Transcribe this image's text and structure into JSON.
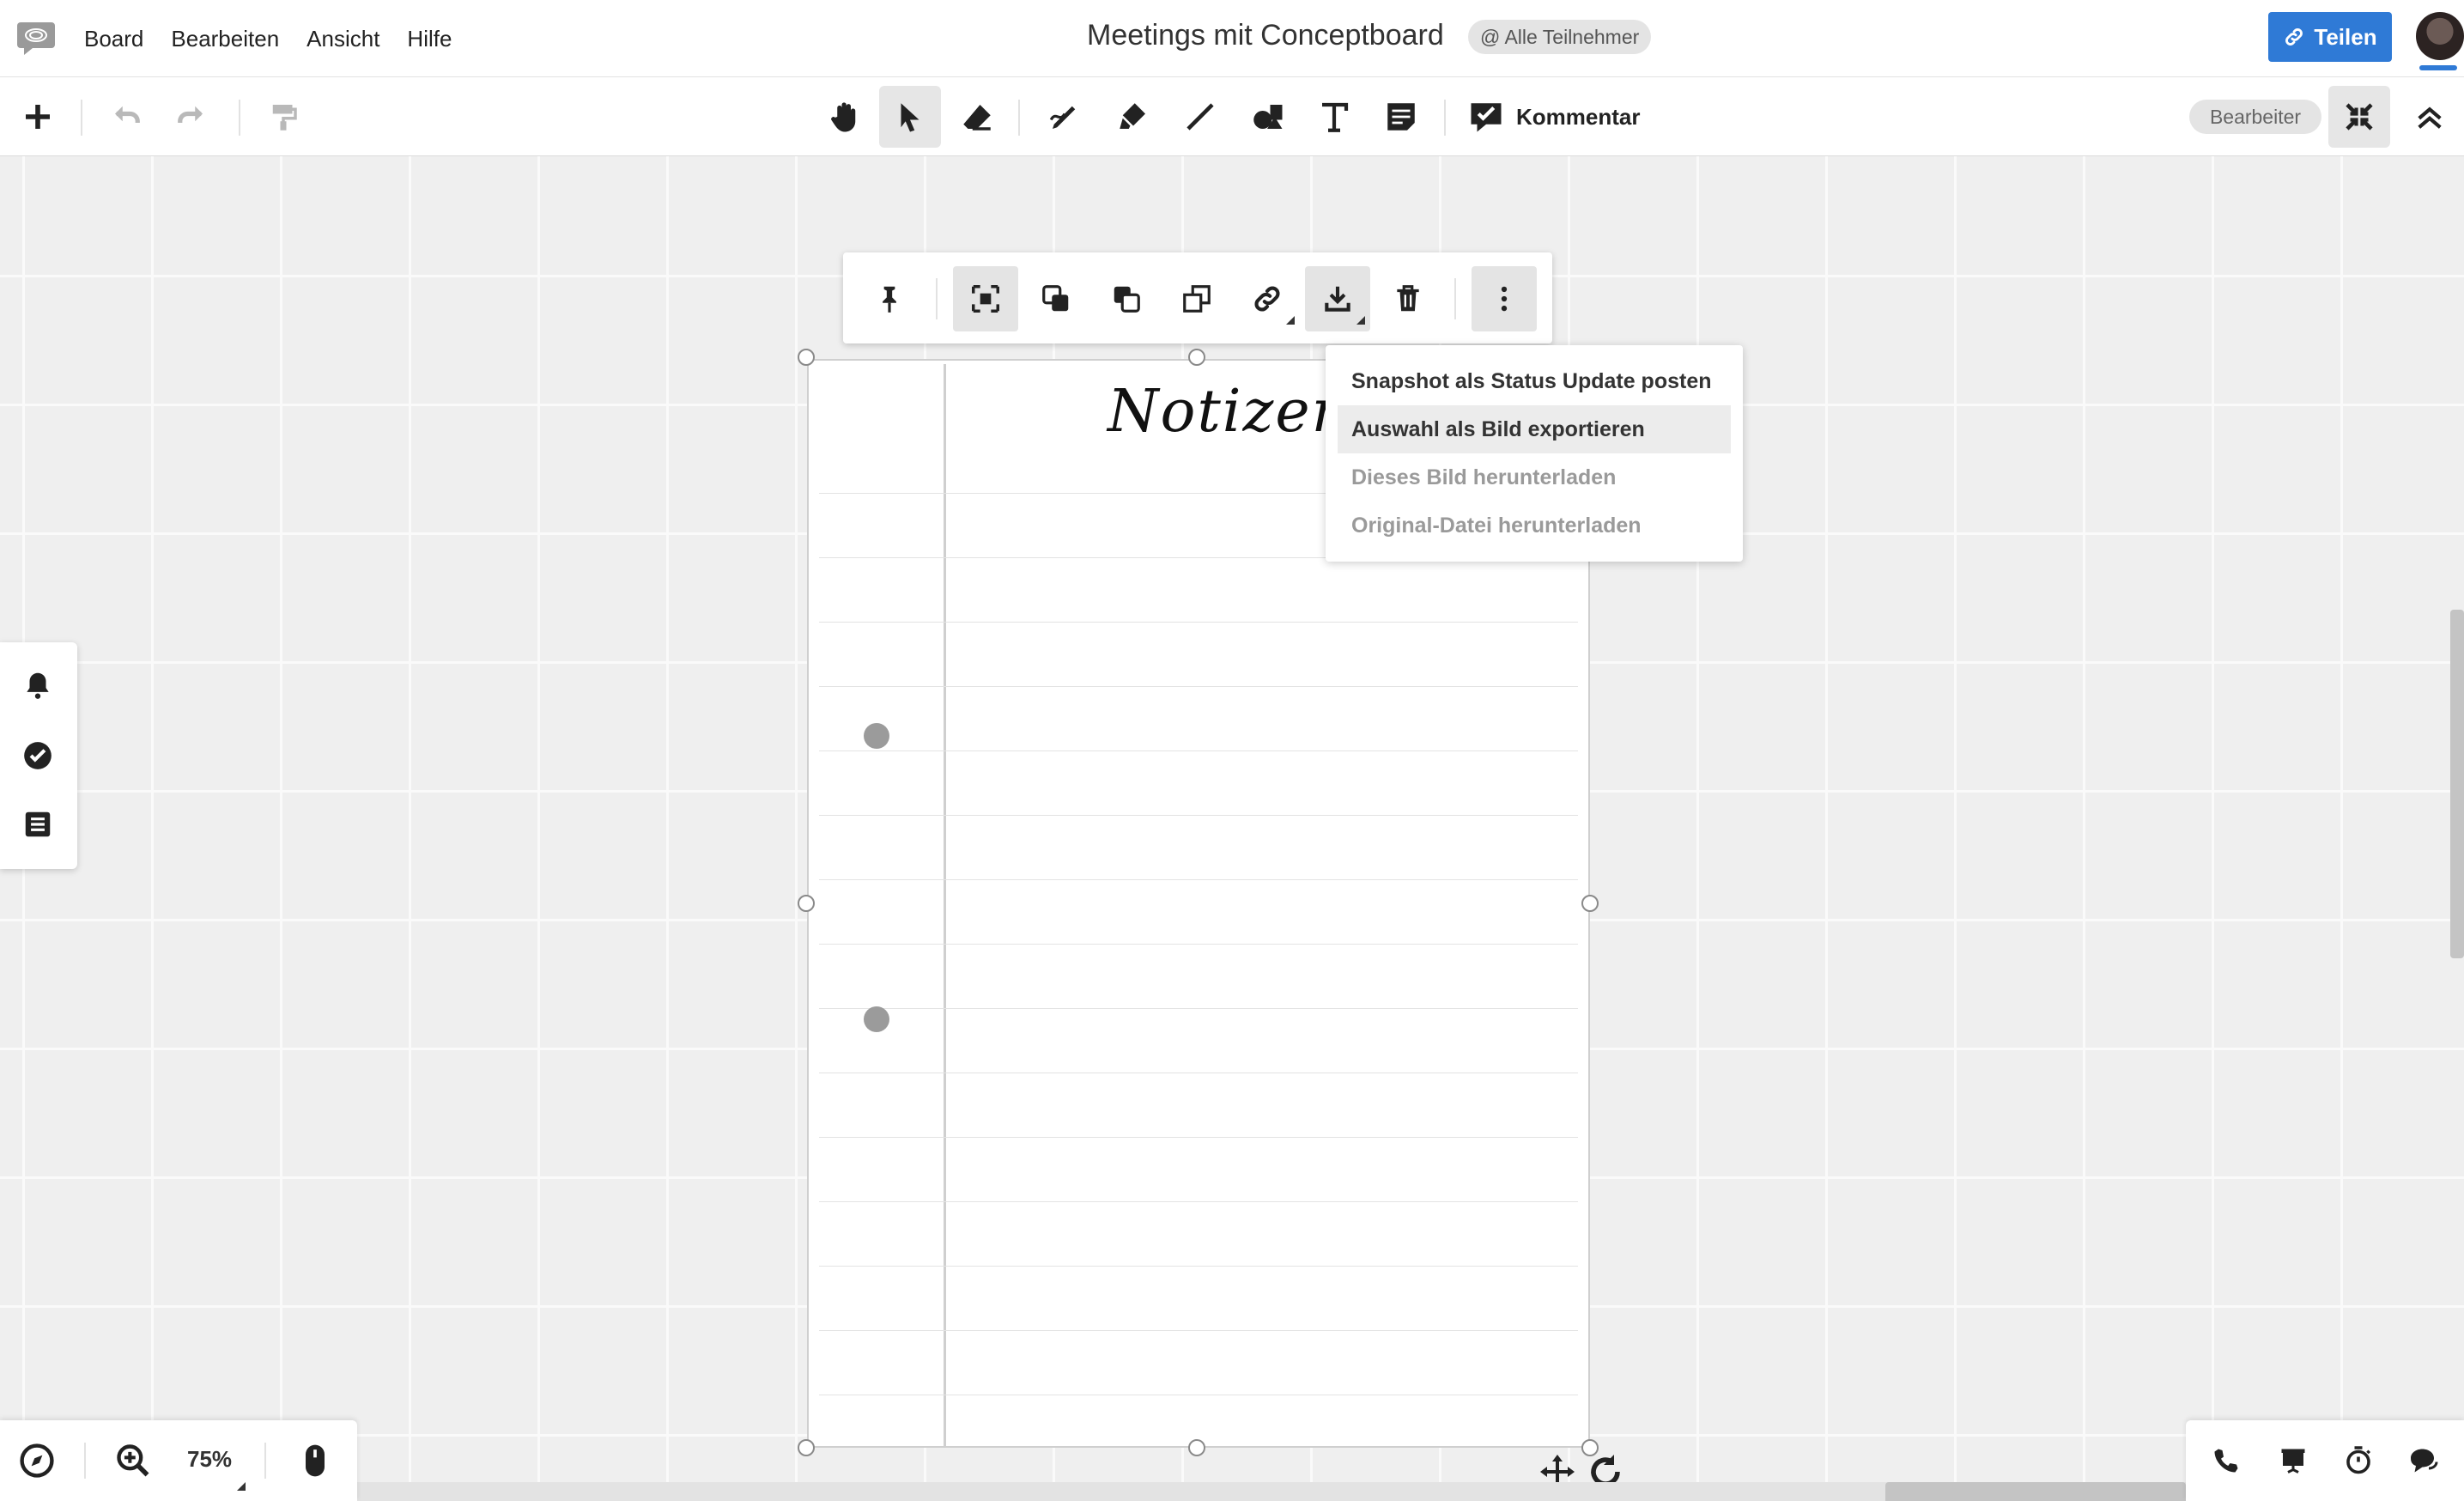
{
  "menubar": {
    "menu_items": [
      "Board",
      "Bearbeiten",
      "Ansicht",
      "Hilfe"
    ],
    "board_title": "Meetings mit Conceptboard",
    "mention": "@ Alle Teilnehmer",
    "share_label": "Teilen"
  },
  "toolbar": {
    "tools": [
      "pan-icon",
      "select-icon",
      "eraser-icon",
      "pen-icon",
      "highlighter-icon",
      "line-icon",
      "shapes-icon",
      "text-icon",
      "sticky-note-icon"
    ],
    "active_tool": "select-icon",
    "comment_label": "Kommentar",
    "role_label": "Bearbeiter"
  },
  "board": {
    "note_title": "Notizen"
  },
  "context_toolbar": {
    "tools": [
      "pin-icon",
      "crop-icon",
      "bring-forward-icon",
      "send-backward-icon",
      "duplicate-icon",
      "link-icon",
      "download-icon",
      "trash-icon",
      "more-icon"
    ],
    "active_tools": [
      "crop-icon",
      "download-icon",
      "more-icon"
    ]
  },
  "download_menu": {
    "items": [
      {
        "label": "Snapshot als Status Update posten",
        "state": "enabled"
      },
      {
        "label": "Auswahl als Bild exportieren",
        "state": "highlighted"
      },
      {
        "label": "Dieses Bild herunterladen",
        "state": "disabled"
      },
      {
        "label": "Original-Datei herunterladen",
        "state": "disabled"
      }
    ]
  },
  "left_panel": {
    "icons": [
      "bell-icon",
      "check-circle-icon",
      "list-icon"
    ]
  },
  "bottom_left": {
    "zoom_level": "75%"
  },
  "bottom_right": {
    "icons": [
      "phone-icon",
      "presentation-icon",
      "timer-icon",
      "chat-icon"
    ]
  },
  "colors": {
    "accent": "#2f7ad6",
    "canvas_bg": "#efefef",
    "grid_line": "#fafafa"
  }
}
